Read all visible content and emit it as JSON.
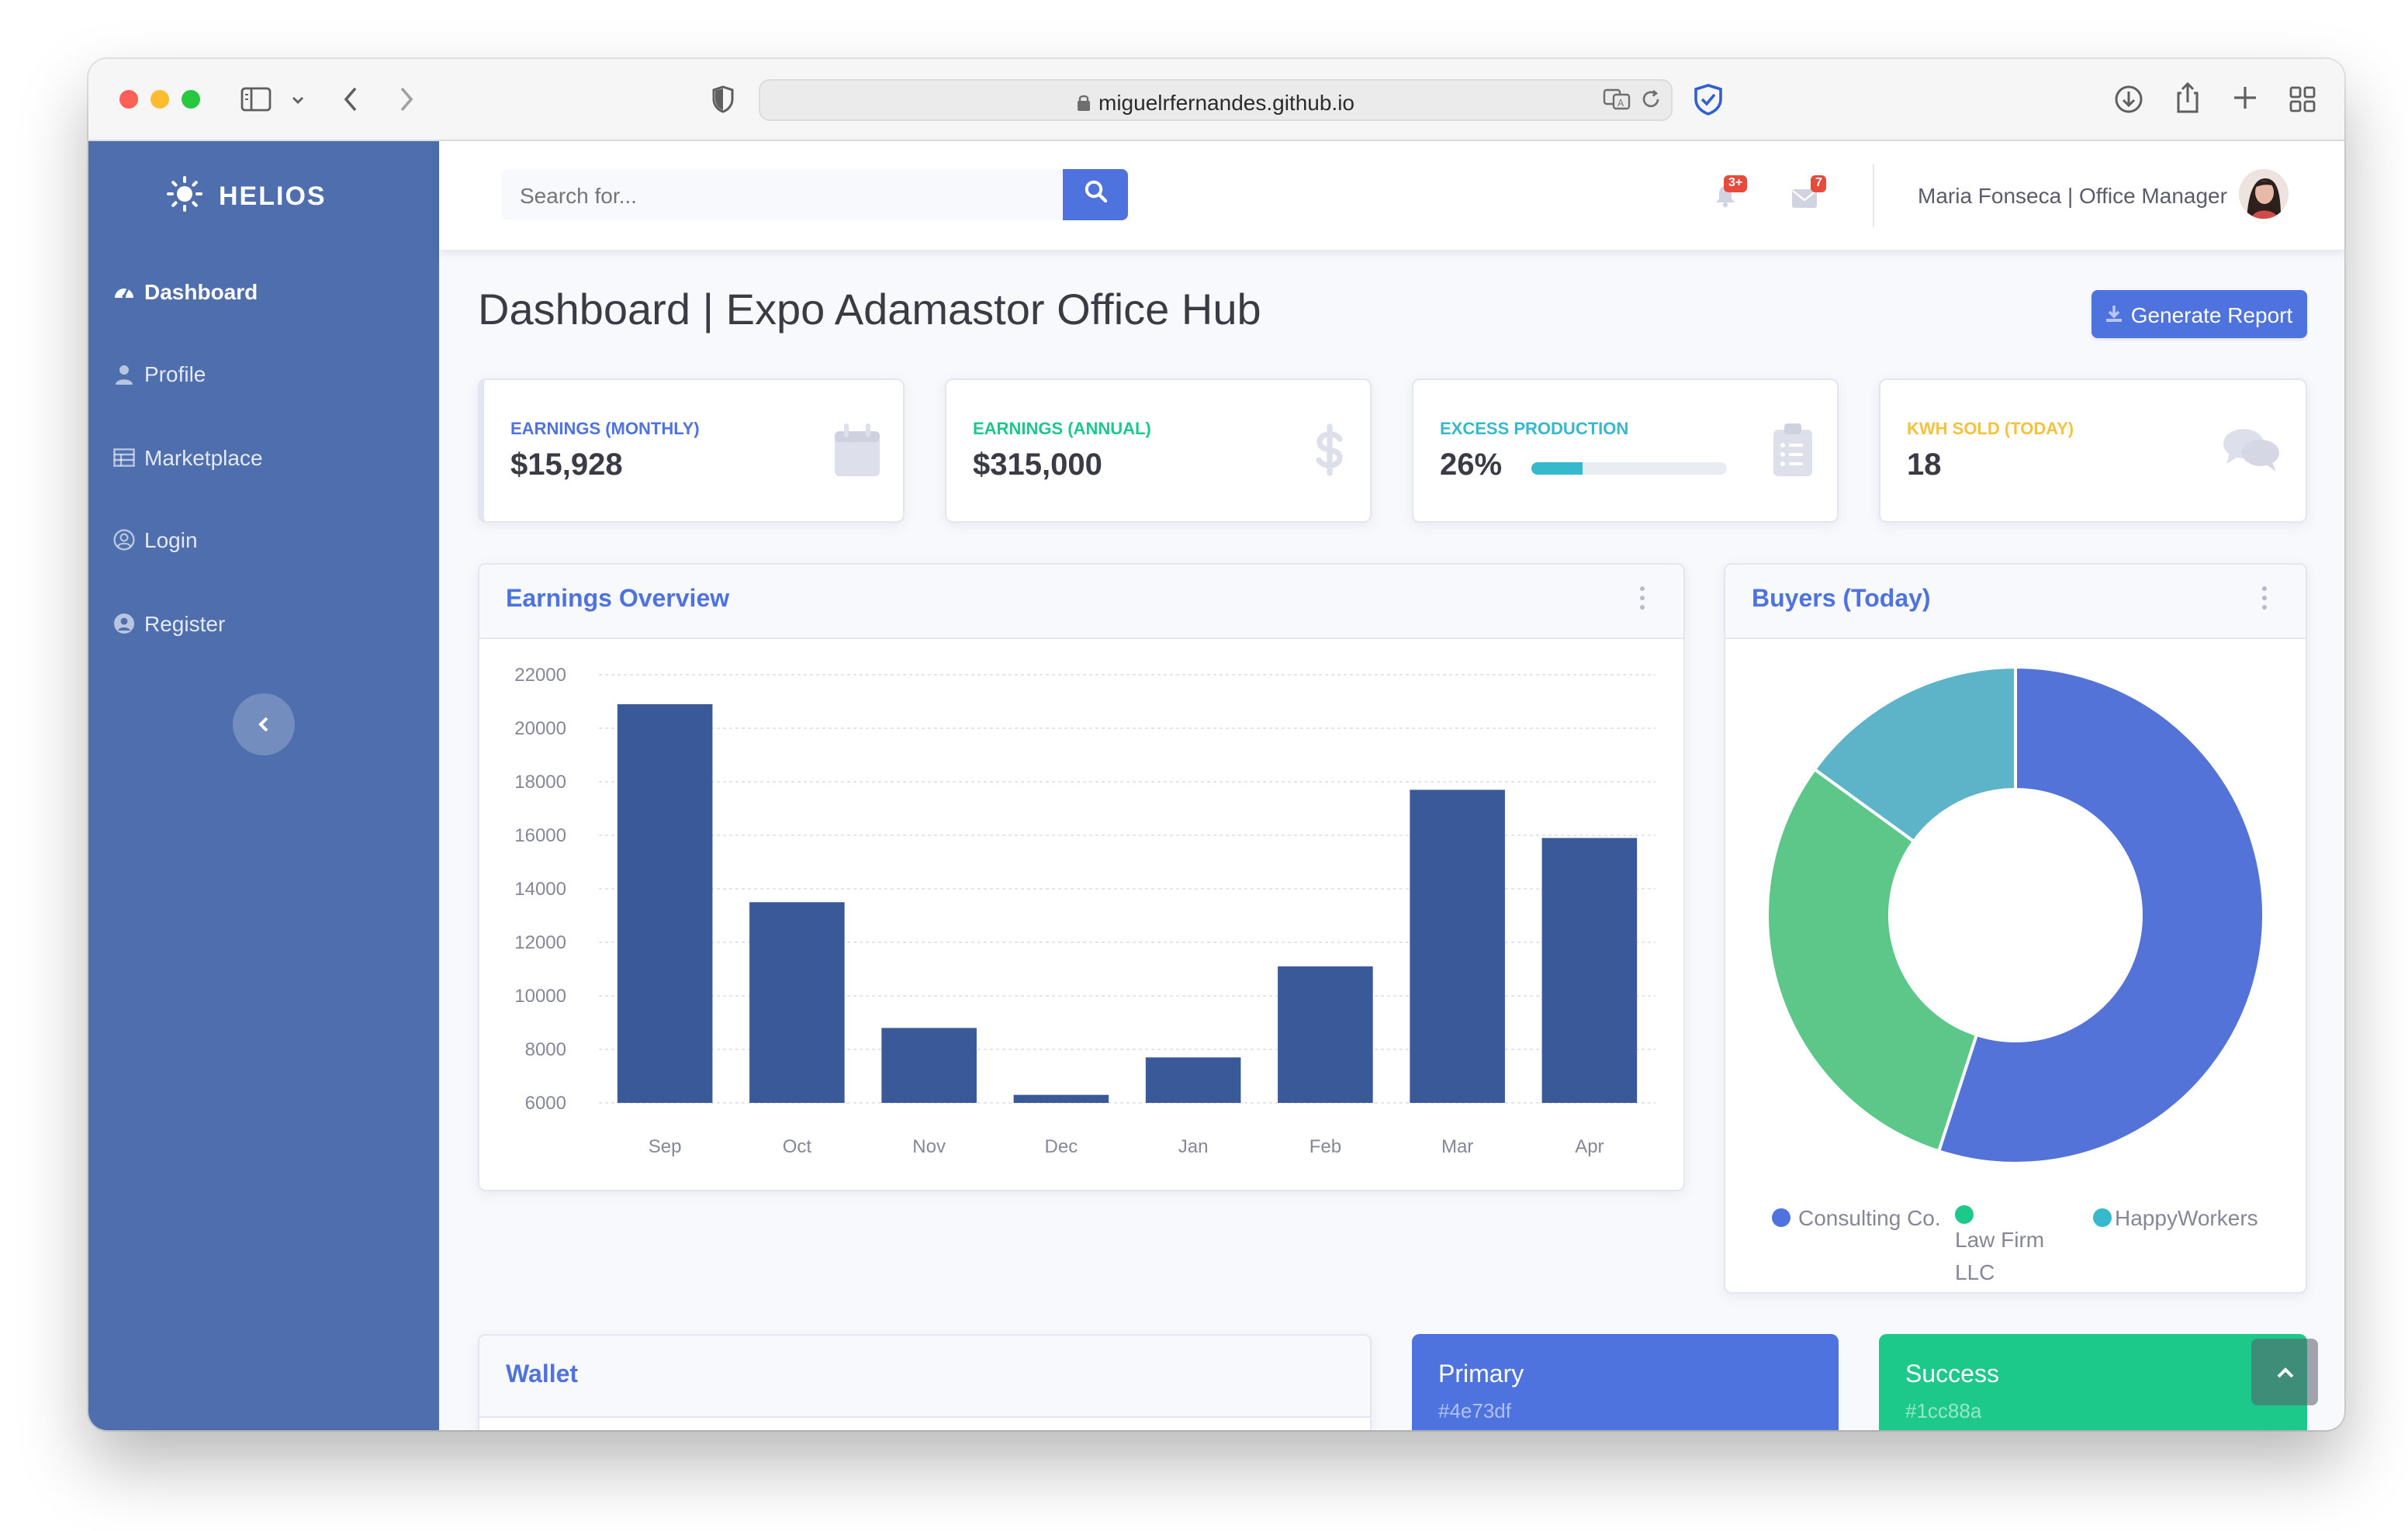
{
  "browser": {
    "url": "miguelrfernandes.github.io"
  },
  "sidebar": {
    "brand": "HELIOS",
    "items": [
      {
        "label": "Dashboard",
        "icon": "tachometer-icon",
        "active": true
      },
      {
        "label": "Profile",
        "icon": "user-icon"
      },
      {
        "label": "Marketplace",
        "icon": "table-icon"
      },
      {
        "label": "Login",
        "icon": "user-circle-icon"
      },
      {
        "label": "Register",
        "icon": "user-circle-solid-icon"
      }
    ]
  },
  "topbar": {
    "search_placeholder": "Search for...",
    "alerts_badge": "3+",
    "messages_badge": "7",
    "user": "Maria Fonseca | Office Manager"
  },
  "page": {
    "title": "Dashboard | Expo Adamastor Office Hub",
    "report_button": "Generate Report"
  },
  "stats": [
    {
      "label": "EARNINGS (MONTHLY)",
      "value": "$15,928",
      "color": "#4e73df",
      "icon": "calendar-icon"
    },
    {
      "label": "EARNINGS (ANNUAL)",
      "value": "$315,000",
      "color": "#1cc88a",
      "icon": "dollar-icon"
    },
    {
      "label": "EXCESS PRODUCTION",
      "value": "26%",
      "color": "#36b9cc",
      "icon": "clipboard-list-icon",
      "progress": 0.26
    },
    {
      "label": "KWH SOLD (TODAY)",
      "value": "18",
      "color": "#f6c23e",
      "icon": "comments-icon"
    }
  ],
  "earnings_card": {
    "title": "Earnings Overview"
  },
  "buyers_card": {
    "title": "Buyers (Today)",
    "legend": [
      {
        "label": "Consulting Co.",
        "color": "#4e73df"
      },
      {
        "label": "Law Firm LLC",
        "color": "#1cc88a"
      },
      {
        "label": "HappyWorkers",
        "color": "#36b9cc"
      }
    ]
  },
  "wallet_card": {
    "title": "Wallet"
  },
  "color_cards": [
    {
      "name": "Primary",
      "hex": "#4e73df",
      "color": "#4e73df"
    },
    {
      "name": "Success",
      "hex": "#1cc88a",
      "color": "#1cc88a"
    }
  ],
  "chart_data": [
    {
      "type": "bar",
      "title": "Earnings Overview",
      "categories": [
        "Sep",
        "Oct",
        "Nov",
        "Dec",
        "Jan",
        "Feb",
        "Mar",
        "Apr"
      ],
      "values": [
        20900,
        13500,
        8800,
        6300,
        7700,
        11100,
        17700,
        15900
      ],
      "ylim": [
        6000,
        22000
      ],
      "yticks": [
        6000,
        8000,
        10000,
        12000,
        14000,
        16000,
        18000,
        20000,
        22000
      ],
      "grid": true,
      "color": "#3a5998"
    },
    {
      "type": "pie",
      "title": "Buyers (Today)",
      "categories": [
        "Consulting Co.",
        "Law Firm LLC",
        "HappyWorkers"
      ],
      "values": [
        55,
        30,
        15
      ],
      "colors": [
        "#5473d8",
        "#5dc78a",
        "#5db4c8"
      ],
      "donut": true
    }
  ]
}
